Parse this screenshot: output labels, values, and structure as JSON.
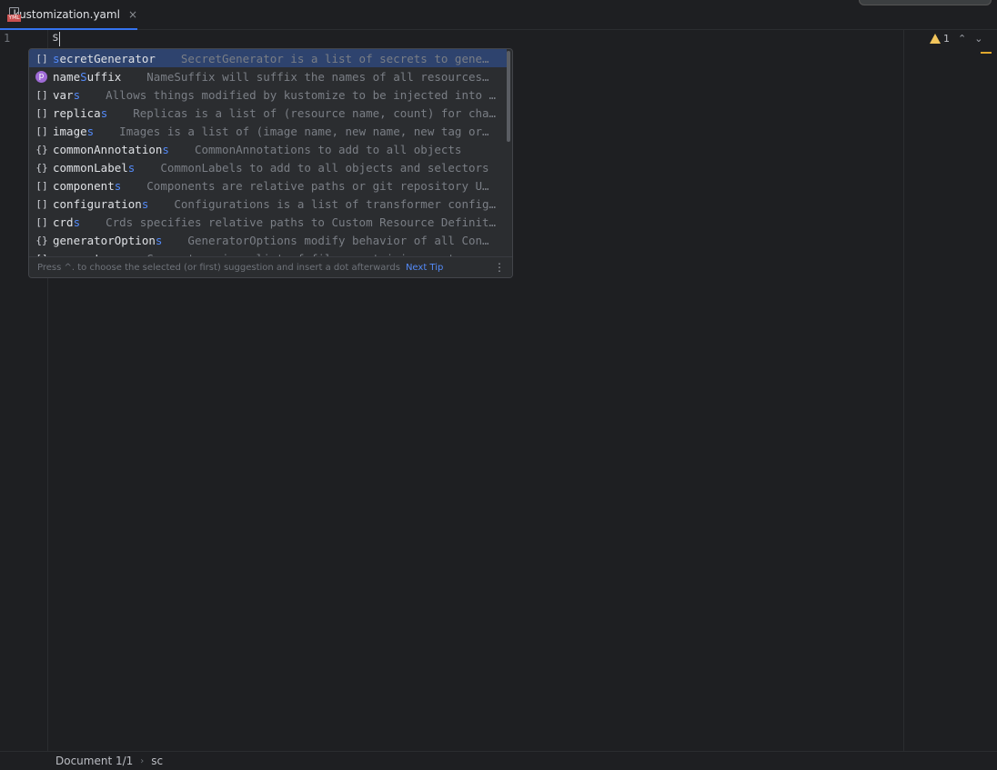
{
  "tab": {
    "filename": "kustomization.yaml",
    "icon_badge": "YML",
    "close": "×"
  },
  "editor": {
    "line_number": "1",
    "typed_text": "s"
  },
  "inspections": {
    "warning_count": "1",
    "prev": "⌃",
    "next": "⌄"
  },
  "completion": {
    "items": [
      {
        "kind": "[]",
        "pre": "",
        "hl": "s",
        "post": "ecretGenerator",
        "desc": "SecretGenerator is a list of secrets to gene…"
      },
      {
        "kind": "p",
        "pre": "name",
        "hl": "S",
        "post": "uffix",
        "desc": "NameSuffix will suffix the names of all resources…"
      },
      {
        "kind": "[]",
        "pre": "var",
        "hl": "s",
        "post": "",
        "desc": "Allows things modified by kustomize to be injected into …"
      },
      {
        "kind": "[]",
        "pre": "replica",
        "hl": "s",
        "post": "",
        "desc": "Replicas is a list of (resource name, count) for cha…"
      },
      {
        "kind": "[]",
        "pre": "image",
        "hl": "s",
        "post": "",
        "desc": "Images is a list of (image name, new name, new tag or…"
      },
      {
        "kind": "{}",
        "pre": "commonAnnotation",
        "hl": "s",
        "post": "",
        "desc": "CommonAnnotations to add to all objects"
      },
      {
        "kind": "{}",
        "pre": "commonLabel",
        "hl": "s",
        "post": "",
        "desc": "CommonLabels to add to all objects and selectors"
      },
      {
        "kind": "[]",
        "pre": "component",
        "hl": "s",
        "post": "",
        "desc": "Components are relative paths or git repository U…"
      },
      {
        "kind": "[]",
        "pre": "configuration",
        "hl": "s",
        "post": "",
        "desc": "Configurations is a list of transformer config…"
      },
      {
        "kind": "[]",
        "pre": "crd",
        "hl": "s",
        "post": "",
        "desc": "Crds specifies relative paths to Custom Resource Definit…"
      },
      {
        "kind": "{}",
        "pre": "generatorOption",
        "hl": "s",
        "post": "",
        "desc": "GeneratorOptions modify behavior of all Con…"
      },
      {
        "kind": "[]",
        "pre": "generator",
        "hl": "s",
        "post": "",
        "desc": "Generators is a list of files containing custom g…"
      }
    ],
    "footer_hint": "Press ^. to choose the selected (or first) suggestion and insert a dot afterwards",
    "footer_link": "Next Tip",
    "footer_more": "⋮"
  },
  "status": {
    "crumb1": "Document 1/1",
    "sep": "›",
    "crumb2": "sc"
  }
}
